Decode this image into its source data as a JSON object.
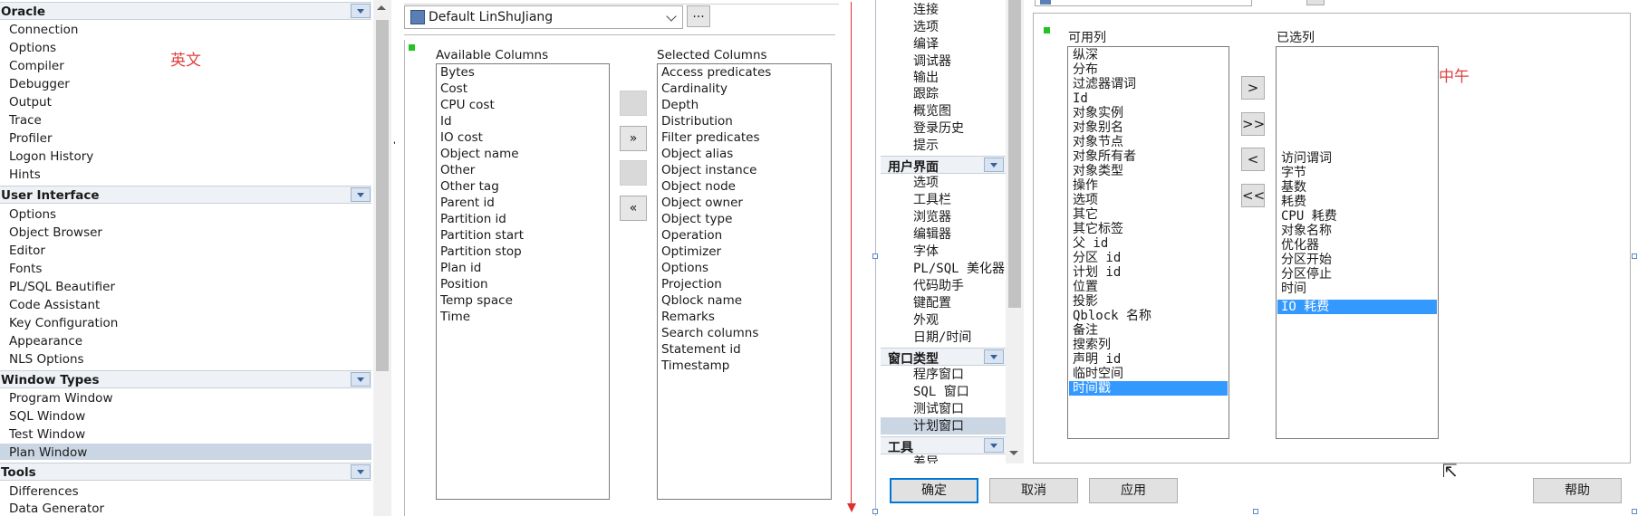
{
  "left_panel": {
    "sections": [
      {
        "title": "Oracle",
        "items": [
          "Connection",
          "Options",
          "Compiler",
          "Debugger",
          "Output",
          "Trace",
          "Profiler",
          "Logon History",
          "Hints"
        ]
      },
      {
        "title": "User Interface",
        "items": [
          "Options",
          "Object Browser",
          "Editor",
          "Fonts",
          "PL/SQL Beautifier",
          "Code Assistant",
          "Key Configuration",
          "Appearance",
          "NLS Options"
        ]
      },
      {
        "title": "Window Types",
        "items": [
          "Program Window",
          "SQL Window",
          "Test Window",
          "Plan Window"
        ],
        "selected": "Plan Window"
      },
      {
        "title": "Tools",
        "items": [
          "Differences",
          "Data Generator"
        ]
      }
    ],
    "annotation": "英文"
  },
  "middle_panel": {
    "template_combo": "Default LinShuJiang",
    "combo_button": "...",
    "available_header": "Available Columns",
    "selected_header": "Selected Columns",
    "available": [
      "Bytes",
      "Cost",
      "CPU cost",
      "Id",
      "IO cost",
      "Object name",
      "Other",
      "Other tag",
      "Parent id",
      "Partition id",
      "Partition start",
      "Partition stop",
      "Plan id",
      "Position",
      "Temp space",
      "Time"
    ],
    "selected": [
      "Access predicates",
      "Cardinality",
      "Depth",
      "Distribution",
      "Filter predicates",
      "Object alias",
      "Object instance",
      "Object node",
      "Object owner",
      "Object type",
      "Operation",
      "Optimizer",
      "Options",
      "Projection",
      "Qblock name",
      "Remarks",
      "Search columns",
      "Statement id",
      "Timestamp"
    ],
    "buttons": {
      "add_all": "»",
      "remove_all": "«"
    }
  },
  "right_panel": {
    "tree_top_items": [
      "连接",
      "选项",
      "编译",
      "调试器",
      "输出",
      "跟踪",
      "概览图",
      "登录历史",
      "提示"
    ],
    "sections": [
      {
        "title": "用户界面",
        "items": [
          "选项",
          "工具栏",
          "浏览器",
          "编辑器",
          "字体",
          "PL/SQL 美化器",
          "代码助手",
          "键配置",
          "外观",
          "日期/时间"
        ]
      },
      {
        "title": "窗口类型",
        "items": [
          "程序窗口",
          "SQL 窗口",
          "测试窗口",
          "计划窗口"
        ],
        "selected": "计划窗口"
      },
      {
        "title": "工具",
        "items": [
          "差异"
        ]
      }
    ],
    "available_header": "可用列",
    "selected_header": "已选列",
    "available": [
      "纵深",
      "分布",
      "过滤器谓词",
      "Id",
      "对象实例",
      "对象别名",
      "对象节点",
      "对象所有者",
      "对象类型",
      "操作",
      "选项",
      "其它",
      "其它标签",
      "父 id",
      "分区 id",
      "计划 id",
      "位置",
      "投影",
      "Qblock 名称",
      "备注",
      "搜索列",
      "声明 id",
      "临时空间",
      "时间戳"
    ],
    "available_selected": "时间戳",
    "selected": [
      "访问谓词",
      "字节",
      "基数",
      "耗费",
      "CPU 耗费",
      "对象名称",
      "优化器",
      "分区开始",
      "分区停止",
      "时间",
      "IO 耗费"
    ],
    "selected_selected": "IO 耗费",
    "arrow_buttons": [
      ">",
      ">>",
      "<",
      "<<"
    ],
    "annotation": "中午",
    "footer": {
      "ok": "确定",
      "cancel": "取消",
      "apply": "应用",
      "help": "帮助"
    }
  }
}
